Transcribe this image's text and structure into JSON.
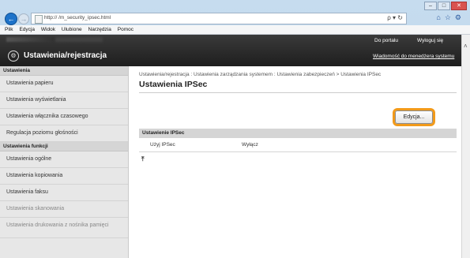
{
  "browser": {
    "url": "http://               /m_security_ipsec.html",
    "address_tools": "ρ ▾ ↻",
    "window_controls": [
      "–",
      "□",
      "✕"
    ],
    "menu": [
      "Plik",
      "Edycja",
      "Widok",
      "Ulubione",
      "Narzędzia",
      "Pomoc"
    ],
    "toolbar_icons": [
      "home-icon",
      "star-icon",
      "gear-icon"
    ],
    "toolbar_glyphs": "⌂☆⚙"
  },
  "header": {
    "title": "Ustawienia/rejestracja",
    "portal_link": "Do portalu",
    "logout_link": "Wyloguj się",
    "message_link": "Wiadomość do menedżera systemu"
  },
  "sidebar": {
    "section1_title": "Ustawienia",
    "section1_items": [
      "Ustawienia papieru",
      "Ustawienia wyświetlania",
      "Ustawienia włącznika czasowego",
      "Regulacja poziomu głośności"
    ],
    "section2_title": "Ustawienia funkcji",
    "section2_items": [
      "Ustawienia ogólne",
      "Ustawienia kopiowania",
      "Ustawienia faksu",
      "Ustawienia skanowania",
      "Ustawienia drukowania z nośnika pamięci"
    ]
  },
  "main": {
    "breadcrumb": "Ustawienia/rejestracja : Ustawienia zarządzania systemem : Ustawienia zabezpieczeń > Ustawienia IPSec",
    "title": "Ustawienia IPSec",
    "edit_button": "Edycja...",
    "section_title": "Ustawienie IPSec",
    "row_label": "Użyj IPSec",
    "row_value": "Wyłącz",
    "to_top_icon": "⤒"
  },
  "colors": {
    "highlight": "#f29a1a",
    "banner": "#2a2a2a",
    "nav_back": "#1e73c9"
  }
}
